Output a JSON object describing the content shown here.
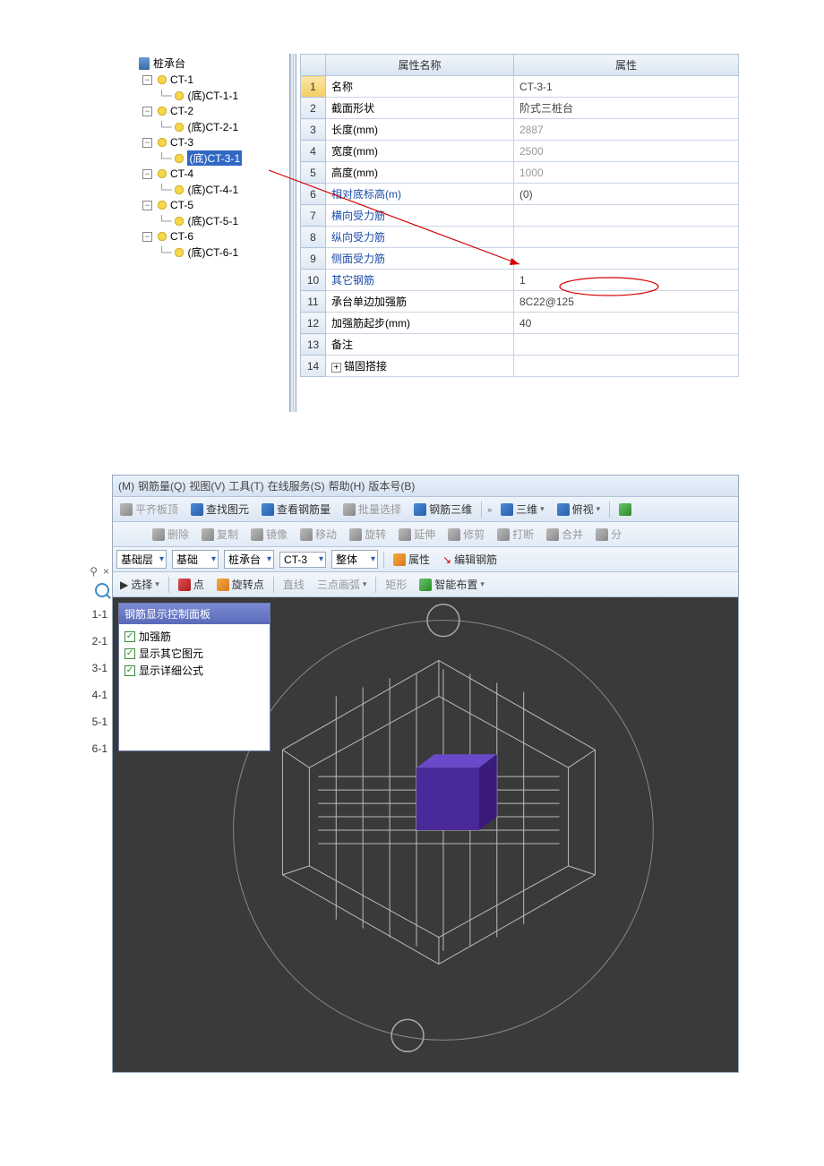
{
  "tree": {
    "root": "桩承台",
    "groups": [
      {
        "name": "CT-1",
        "child": "(底)CT-1-1",
        "selected": false
      },
      {
        "name": "CT-2",
        "child": "(底)CT-2-1",
        "selected": false
      },
      {
        "name": "CT-3",
        "child": "(底)CT-3-1",
        "selected": true
      },
      {
        "name": "CT-4",
        "child": "(底)CT-4-1",
        "selected": false
      },
      {
        "name": "CT-5",
        "child": "(底)CT-5-1",
        "selected": false
      },
      {
        "name": "CT-6",
        "child": "(底)CT-6-1",
        "selected": false
      }
    ]
  },
  "prop": {
    "header_name": "属性名称",
    "header_val": "属性",
    "rows": [
      {
        "n": "1",
        "name": "名称",
        "val": "CT-3-1",
        "link": false,
        "dim": false
      },
      {
        "n": "2",
        "name": "截面形状",
        "val": "阶式三桩台",
        "link": false,
        "dim": false
      },
      {
        "n": "3",
        "name": "长度(mm)",
        "val": "2887",
        "link": false,
        "dim": true
      },
      {
        "n": "4",
        "name": "宽度(mm)",
        "val": "2500",
        "link": false,
        "dim": true
      },
      {
        "n": "5",
        "name": "高度(mm)",
        "val": "1000",
        "link": false,
        "dim": true
      },
      {
        "n": "6",
        "name": "相对底标高(m)",
        "val": "(0)",
        "link": true,
        "dim": false
      },
      {
        "n": "7",
        "name": "横向受力筋",
        "val": "",
        "link": true,
        "dim": false
      },
      {
        "n": "8",
        "name": "纵向受力筋",
        "val": "",
        "link": true,
        "dim": false
      },
      {
        "n": "9",
        "name": "侧面受力筋",
        "val": "",
        "link": true,
        "dim": false
      },
      {
        "n": "10",
        "name": "其它钢筋",
        "val": "1",
        "link": true,
        "dim": false
      },
      {
        "n": "11",
        "name": "承台单边加强筋",
        "val": "8C22@125",
        "link": false,
        "dim": false
      },
      {
        "n": "12",
        "name": "加强筋起步(mm)",
        "val": "40",
        "link": false,
        "dim": false
      },
      {
        "n": "13",
        "name": "备注",
        "val": "",
        "link": false,
        "dim": false
      },
      {
        "n": "14",
        "name": "锚固搭接",
        "val": "",
        "link": false,
        "dim": true,
        "expand": true
      }
    ],
    "active_row": "1"
  },
  "menu": {
    "items": [
      {
        "label": "(M)",
        "pre": ""
      },
      {
        "label": "钢筋量(Q)",
        "pre": ""
      },
      {
        "label": "视图(V)",
        "pre": ""
      },
      {
        "label": "工具(T)",
        "pre": ""
      },
      {
        "label": "在线服务(S)",
        "pre": ""
      },
      {
        "label": "帮助(H)",
        "pre": ""
      },
      {
        "label": "版本号(B)",
        "pre": ""
      }
    ]
  },
  "toolbar1": {
    "pingqi": "平齐板顶",
    "chazhao": "查找图元",
    "chakan": "查看钢筋量",
    "piliang": "批量选择",
    "gangjin3d": "钢筋三维",
    "sanwei": "三维",
    "fushi": "俯视"
  },
  "toolbar2": {
    "pin": "×",
    "pinlock": "⟂",
    "shanchu": "删除",
    "fuzhi": "复制",
    "jingxiang": "镜像",
    "yidong": "移动",
    "xuanzhuan": "旋转",
    "yanshen": "延伸",
    "xiujian": "修剪",
    "dadua": "打断",
    "hebing": "合并",
    "fen": "分"
  },
  "toolbar3": {
    "dd1": "基础层",
    "dd2": "基础",
    "dd3": "桩承台",
    "dd4": "CT-3",
    "dd5": "整体",
    "shuxing": "属性",
    "bianji": "编辑钢筋"
  },
  "toolbar4": {
    "xuanze": "选择",
    "dian": "点",
    "xuanzdian": "旋转点",
    "zhixian": "直线",
    "sandian": "三点画弧",
    "juxing": "矩形",
    "zhineng": "智能布置"
  },
  "leftlabels": [
    "1-1",
    "2-1",
    "3-1",
    "4-1",
    "5-1",
    "6-1"
  ],
  "panel": {
    "title": "钢筋显示控制面板",
    "opts": [
      "加强筋",
      "显示其它图元",
      "显示详细公式"
    ]
  }
}
